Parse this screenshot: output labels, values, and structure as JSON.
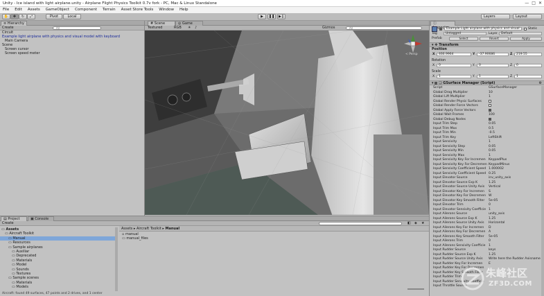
{
  "window": {
    "title": "Unity - Ice island with light airplane.unity - Airplane Flight Physics Toolkit 0.7v fork - PC, Mac & Linux Standalone",
    "controls": [
      "—",
      "□",
      "✕"
    ]
  },
  "menu": [
    "File",
    "Edit",
    "Assets",
    "GameObject",
    "Component",
    "Terrain",
    "Asset Store Tools",
    "Window",
    "Help"
  ],
  "toolbar": {
    "pivot": "Pivot",
    "local": "Local",
    "layers": "Layers",
    "layout": "Layout"
  },
  "hierarchy": {
    "tab": "Hierarchy",
    "create": "Create",
    "search_placeholder": "All",
    "items": [
      {
        "label": "Circuit",
        "indent": 0,
        "color": "#1a1a1a"
      },
      {
        "label": "Example light airplane with physics and visual model with keyboard",
        "indent": 0,
        "color": "#1a2a9a"
      },
      {
        "label": "Main Camera",
        "indent": 1,
        "color": "#1a1a1a"
      },
      {
        "label": "Scene",
        "indent": 0,
        "color": "#1a1a1a"
      },
      {
        "label": "Screen cursor",
        "indent": 1,
        "color": "#1a1a1a"
      },
      {
        "label": "Screen speed meter",
        "indent": 1,
        "color": "#1a1a1a"
      }
    ]
  },
  "scene": {
    "tabs": [
      "Scene",
      "Game"
    ],
    "shading": "Textured",
    "render": "RGB",
    "gizmos": "Gizmos",
    "search_placeholder": "All",
    "persp": "< Persp"
  },
  "project": {
    "tabs": [
      "Project",
      "Console"
    ],
    "create": "Create",
    "breadcrumb": [
      "Assets",
      "Aircraft Toolkit",
      "Manual"
    ],
    "tree": [
      {
        "label": "Assets",
        "indent": 0,
        "bold": true
      },
      {
        "label": "Aircraft Toolkit",
        "indent": 1
      },
      {
        "label": "Manual",
        "indent": 2,
        "selected": true
      },
      {
        "label": "Resources",
        "indent": 2
      },
      {
        "label": "Sample airplanes",
        "indent": 2
      },
      {
        "label": "Auxiliar",
        "indent": 3
      },
      {
        "label": "Deprecated",
        "indent": 3
      },
      {
        "label": "Materials",
        "indent": 3
      },
      {
        "label": "Model",
        "indent": 3
      },
      {
        "label": "Sounds",
        "indent": 3
      },
      {
        "label": "Textures",
        "indent": 3
      },
      {
        "label": "Sample scenes",
        "indent": 2
      },
      {
        "label": "Materials",
        "indent": 3
      },
      {
        "label": "Models",
        "indent": 3
      }
    ],
    "files": [
      "manual",
      "manual_files"
    ],
    "status": "Aircraft: found 49 surfaces, 47 points and 2 drives, and 1 center"
  },
  "inspector": {
    "tab": "Inspector",
    "object_name": "Example Light airplane with physics and visual",
    "static_label": "Static",
    "tag_label": "Tag",
    "tag_value": "Untagged",
    "layer_label": "Layer",
    "layer_value": "Default",
    "prefab_label": "Prefab",
    "prefab_buttons": [
      "Select",
      "Revert",
      "Apply"
    ],
    "transform_title": "Transform",
    "position_label": "Position",
    "rotation_label": "Rotation",
    "scale_label": "Scale",
    "position": {
      "x": "466.9964",
      "y": "-37.90686",
      "z": "219.55"
    },
    "rotation": {
      "x": "0",
      "y": "0",
      "z": "0"
    },
    "scale": {
      "x": "1",
      "y": "1",
      "z": "1"
    },
    "script_title": "GSurface Manager (Script)",
    "properties": [
      {
        "label": "Script",
        "value": "GSurfaceManager"
      },
      {
        "label": "Global Drag Multiplier",
        "value": "10"
      },
      {
        "label": "Global Lift Multiplier",
        "value": "1"
      },
      {
        "label": "Global Render Physic Surfaces",
        "check": false
      },
      {
        "label": "Global Render Force Vectors",
        "check": false
      },
      {
        "label": "Global Apply Force Vectors",
        "check": true
      },
      {
        "label": "Global Wait Frames",
        "value": "100"
      },
      {
        "label": "Global Debug Nodes",
        "check": true
      },
      {
        "label": "Input Trim Step",
        "value": "0.05"
      },
      {
        "label": "Input Trim Max",
        "value": "0.5"
      },
      {
        "label": "Input Trim Min",
        "value": "-0.5"
      },
      {
        "label": "Input Trim Key",
        "value": "LeftShift"
      },
      {
        "label": "Input Sensivity",
        "value": "1"
      },
      {
        "label": "Input Sensivity Step",
        "value": "0.05"
      },
      {
        "label": "Input Sensivity Min",
        "value": "0.05"
      },
      {
        "label": "Input Sensivity Max",
        "value": "1"
      },
      {
        "label": "Input Sensivity Key For Incremen",
        "value": "KeypadPlus"
      },
      {
        "label": "Input Sensivity Key For Decremen",
        "value": "KeypadMinus"
      },
      {
        "label": "Input Sensivity Coefficient Speed",
        "value": "1.000002"
      },
      {
        "label": "Input Sensivity Coefficient Speed",
        "value": "0.25"
      },
      {
        "label": "Input Elevator Source",
        "value": "inv_unity_axis"
      },
      {
        "label": "Input Elevator Source Exp K",
        "value": "1.25"
      },
      {
        "label": "Input Elevator Source Unity Axis",
        "value": "Vertical"
      },
      {
        "label": "Input Elevator Key For Incremen",
        "value": "S"
      },
      {
        "label": "Input Elevator Key For Decremen",
        "value": "W"
      },
      {
        "label": "Input Elevator Key Smooth Filter",
        "value": "5e-05"
      },
      {
        "label": "Input Elevator Trim",
        "value": "0"
      },
      {
        "label": "Input Elevator Sensivity Coefficie",
        "value": "1"
      },
      {
        "label": "Input Ailerons Source",
        "value": "unity_axis"
      },
      {
        "label": "Input Ailerons Source Exp K",
        "value": "1.25"
      },
      {
        "label": "Input Ailerons Source Unity Axis",
        "value": "Horizontal"
      },
      {
        "label": "Input Ailerons Key For Incremen",
        "value": "D"
      },
      {
        "label": "Input Ailerons Key For Decremen",
        "value": "A"
      },
      {
        "label": "Input Ailerons Key Smooth Filter",
        "value": "5e-05"
      },
      {
        "label": "Input Ailerons Trim",
        "value": "0"
      },
      {
        "label": "Input Ailerons Sensivity Coefficie",
        "value": "1"
      },
      {
        "label": "Input Rudder Source",
        "value": "keys"
      },
      {
        "label": "Input Rudder Source Exp K",
        "value": "1.25"
      },
      {
        "label": "Input Rudder Source Unity Axis",
        "value": "Write here the Rudder Axisname"
      },
      {
        "label": "Input Rudder Key For Incremen",
        "value": "E"
      },
      {
        "label": "Input Rudder Key For Decremen",
        "value": ""
      },
      {
        "label": "Input Rudder Key Smooth Filter",
        "value": ""
      },
      {
        "label": "Input Rudder Trim",
        "value": ""
      },
      {
        "label": "Input Rudder Sensivity Coefficie",
        "value": ""
      },
      {
        "label": "Input Throttle Source",
        "value": ""
      }
    ]
  },
  "watermark": {
    "cn": "朱峰社区",
    "en": "ZF3D.COM"
  }
}
